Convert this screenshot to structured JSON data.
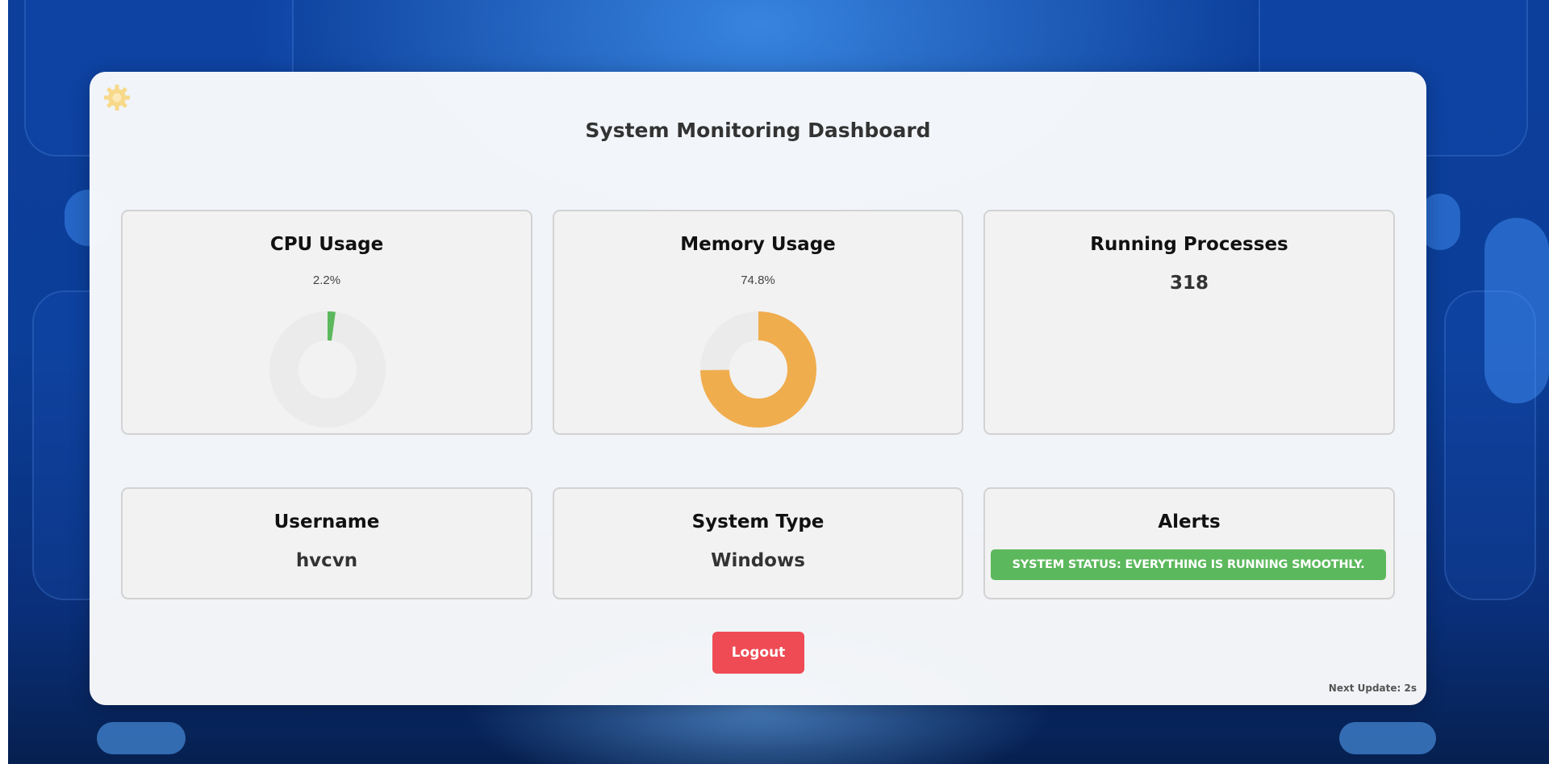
{
  "page": {
    "title": "System Monitoring Dashboard"
  },
  "icons": {
    "settings": "gear-icon"
  },
  "colors": {
    "cpu": "#5cb85c",
    "memory": "#f0ad4e",
    "donut_track": "#ebebeb",
    "logout": "#ef4b55",
    "alert_ok": "#5cb85c"
  },
  "cards": {
    "cpu": {
      "title": "CPU Usage",
      "value_text": "2.2%",
      "percent": 2.2
    },
    "memory": {
      "title": "Memory Usage",
      "value_text": "74.8%",
      "percent": 74.8
    },
    "processes": {
      "title": "Running Processes",
      "value": "318"
    },
    "username": {
      "title": "Username",
      "value": "hvcvn"
    },
    "system_type": {
      "title": "System Type",
      "value": "Windows"
    },
    "alerts": {
      "title": "Alerts",
      "message": "SYSTEM STATUS: EVERYTHING IS RUNNING SMOOTHLY."
    }
  },
  "actions": {
    "logout_label": "Logout"
  },
  "footer": {
    "next_update": "Next Update: 2s"
  }
}
